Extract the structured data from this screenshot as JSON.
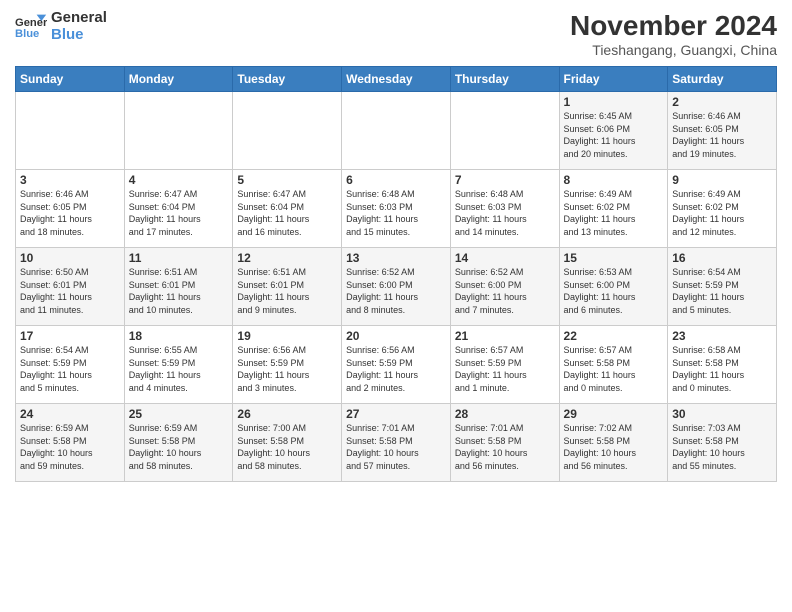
{
  "logo": {
    "line1": "General",
    "line2": "Blue"
  },
  "title": "November 2024",
  "location": "Tieshangang, Guangxi, China",
  "days_of_week": [
    "Sunday",
    "Monday",
    "Tuesday",
    "Wednesday",
    "Thursday",
    "Friday",
    "Saturday"
  ],
  "weeks": [
    [
      {
        "day": "",
        "text": ""
      },
      {
        "day": "",
        "text": ""
      },
      {
        "day": "",
        "text": ""
      },
      {
        "day": "",
        "text": ""
      },
      {
        "day": "",
        "text": ""
      },
      {
        "day": "1",
        "text": "Sunrise: 6:45 AM\nSunset: 6:06 PM\nDaylight: 11 hours\nand 20 minutes."
      },
      {
        "day": "2",
        "text": "Sunrise: 6:46 AM\nSunset: 6:05 PM\nDaylight: 11 hours\nand 19 minutes."
      }
    ],
    [
      {
        "day": "3",
        "text": "Sunrise: 6:46 AM\nSunset: 6:05 PM\nDaylight: 11 hours\nand 18 minutes."
      },
      {
        "day": "4",
        "text": "Sunrise: 6:47 AM\nSunset: 6:04 PM\nDaylight: 11 hours\nand 17 minutes."
      },
      {
        "day": "5",
        "text": "Sunrise: 6:47 AM\nSunset: 6:04 PM\nDaylight: 11 hours\nand 16 minutes."
      },
      {
        "day": "6",
        "text": "Sunrise: 6:48 AM\nSunset: 6:03 PM\nDaylight: 11 hours\nand 15 minutes."
      },
      {
        "day": "7",
        "text": "Sunrise: 6:48 AM\nSunset: 6:03 PM\nDaylight: 11 hours\nand 14 minutes."
      },
      {
        "day": "8",
        "text": "Sunrise: 6:49 AM\nSunset: 6:02 PM\nDaylight: 11 hours\nand 13 minutes."
      },
      {
        "day": "9",
        "text": "Sunrise: 6:49 AM\nSunset: 6:02 PM\nDaylight: 11 hours\nand 12 minutes."
      }
    ],
    [
      {
        "day": "10",
        "text": "Sunrise: 6:50 AM\nSunset: 6:01 PM\nDaylight: 11 hours\nand 11 minutes."
      },
      {
        "day": "11",
        "text": "Sunrise: 6:51 AM\nSunset: 6:01 PM\nDaylight: 11 hours\nand 10 minutes."
      },
      {
        "day": "12",
        "text": "Sunrise: 6:51 AM\nSunset: 6:01 PM\nDaylight: 11 hours\nand 9 minutes."
      },
      {
        "day": "13",
        "text": "Sunrise: 6:52 AM\nSunset: 6:00 PM\nDaylight: 11 hours\nand 8 minutes."
      },
      {
        "day": "14",
        "text": "Sunrise: 6:52 AM\nSunset: 6:00 PM\nDaylight: 11 hours\nand 7 minutes."
      },
      {
        "day": "15",
        "text": "Sunrise: 6:53 AM\nSunset: 6:00 PM\nDaylight: 11 hours\nand 6 minutes."
      },
      {
        "day": "16",
        "text": "Sunrise: 6:54 AM\nSunset: 5:59 PM\nDaylight: 11 hours\nand 5 minutes."
      }
    ],
    [
      {
        "day": "17",
        "text": "Sunrise: 6:54 AM\nSunset: 5:59 PM\nDaylight: 11 hours\nand 5 minutes."
      },
      {
        "day": "18",
        "text": "Sunrise: 6:55 AM\nSunset: 5:59 PM\nDaylight: 11 hours\nand 4 minutes."
      },
      {
        "day": "19",
        "text": "Sunrise: 6:56 AM\nSunset: 5:59 PM\nDaylight: 11 hours\nand 3 minutes."
      },
      {
        "day": "20",
        "text": "Sunrise: 6:56 AM\nSunset: 5:59 PM\nDaylight: 11 hours\nand 2 minutes."
      },
      {
        "day": "21",
        "text": "Sunrise: 6:57 AM\nSunset: 5:59 PM\nDaylight: 11 hours\nand 1 minute."
      },
      {
        "day": "22",
        "text": "Sunrise: 6:57 AM\nSunset: 5:58 PM\nDaylight: 11 hours\nand 0 minutes."
      },
      {
        "day": "23",
        "text": "Sunrise: 6:58 AM\nSunset: 5:58 PM\nDaylight: 11 hours\nand 0 minutes."
      }
    ],
    [
      {
        "day": "24",
        "text": "Sunrise: 6:59 AM\nSunset: 5:58 PM\nDaylight: 10 hours\nand 59 minutes."
      },
      {
        "day": "25",
        "text": "Sunrise: 6:59 AM\nSunset: 5:58 PM\nDaylight: 10 hours\nand 58 minutes."
      },
      {
        "day": "26",
        "text": "Sunrise: 7:00 AM\nSunset: 5:58 PM\nDaylight: 10 hours\nand 58 minutes."
      },
      {
        "day": "27",
        "text": "Sunrise: 7:01 AM\nSunset: 5:58 PM\nDaylight: 10 hours\nand 57 minutes."
      },
      {
        "day": "28",
        "text": "Sunrise: 7:01 AM\nSunset: 5:58 PM\nDaylight: 10 hours\nand 56 minutes."
      },
      {
        "day": "29",
        "text": "Sunrise: 7:02 AM\nSunset: 5:58 PM\nDaylight: 10 hours\nand 56 minutes."
      },
      {
        "day": "30",
        "text": "Sunrise: 7:03 AM\nSunset: 5:58 PM\nDaylight: 10 hours\nand 55 minutes."
      }
    ]
  ]
}
